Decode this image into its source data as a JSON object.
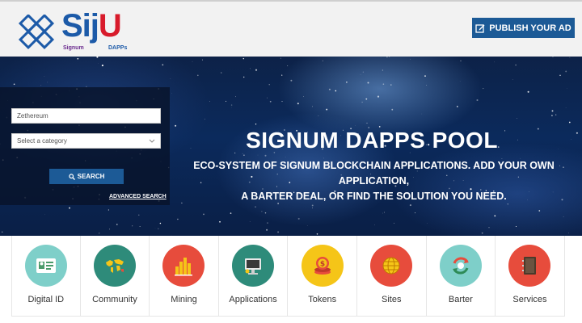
{
  "header": {
    "logo_text": "SijU",
    "logo_sub_left": "Signum",
    "logo_sub_right": "DAPPs",
    "publish_label": "PUBLISH YOUR AD"
  },
  "search": {
    "keyword_value": "Zethereum",
    "category_value": "Select a category",
    "search_label": "SEARCH",
    "advanced_label": "ADVANCED SEARCH"
  },
  "hero": {
    "title": "SIGNUM DAPPS POOL",
    "subtitle_line1": "ECO-SYSTEM OF SIGNUM BLOCKCHAIN APPLICATIONS. ADD YOUR OWN APPLICATION,",
    "subtitle_line2": "A BARTER DEAL, OR FIND THE SOLUTION YOU NEED."
  },
  "categories": [
    {
      "label": "Digital ID",
      "icon": "id-card-icon",
      "color": "#7ecfc9"
    },
    {
      "label": "Community",
      "icon": "world-map-icon",
      "color": "#2e8b7a"
    },
    {
      "label": "Mining",
      "icon": "bar-chart-icon",
      "color": "#e74c3c"
    },
    {
      "label": "Applications",
      "icon": "monitor-icon",
      "color": "#2e8b7a"
    },
    {
      "label": "Tokens",
      "icon": "coin-icon",
      "color": "#f5c518"
    },
    {
      "label": "Sites",
      "icon": "globe-icon",
      "color": "#e74c3c"
    },
    {
      "label": "Barter",
      "icon": "exchange-icon",
      "color": "#7ecfc9"
    },
    {
      "label": "Services",
      "icon": "book-icon",
      "color": "#e74c3c"
    }
  ],
  "colors": {
    "brand_blue": "#1c5a96",
    "logo_red": "#d81b2b"
  }
}
